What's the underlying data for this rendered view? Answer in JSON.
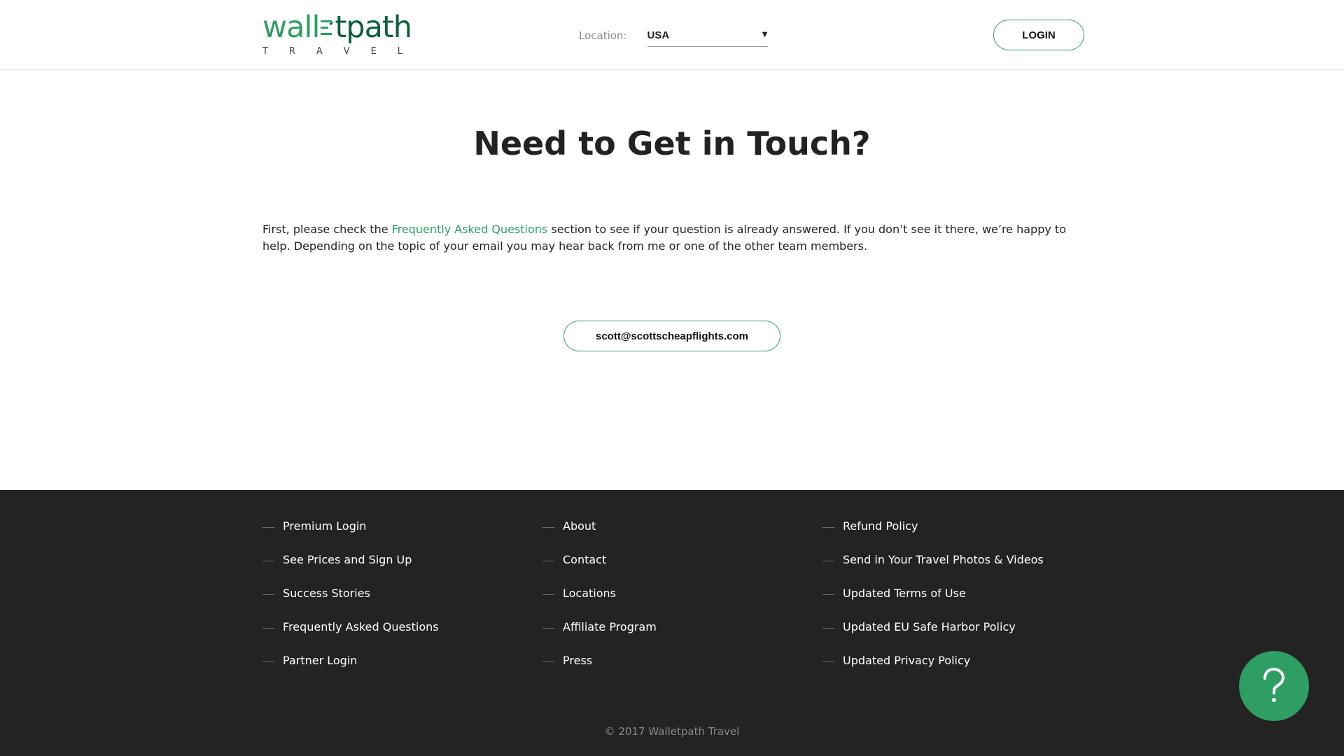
{
  "header": {
    "logo": {
      "word_left": "wall",
      "word_right": "tpath",
      "subtitle_letters": [
        "T",
        "R",
        "A",
        "V",
        "E",
        "L"
      ]
    },
    "location": {
      "label": "Location:",
      "value": "USA"
    },
    "login_label": "LOGIN"
  },
  "main": {
    "title": "Need to Get in Touch?",
    "intro_before": "First, please check the ",
    "intro_link": "Frequently Asked Questions",
    "intro_after": " section to see if your question is already answered. If you don’t see it there, we’re happy to help. Depending on the topic of your email you may hear back from me or one of the other team members.",
    "email_button": "scott@scottscheapflights.com"
  },
  "footer": {
    "columns": [
      [
        "Premium Login",
        "See Prices and Sign Up",
        "Success Stories",
        "Frequently Asked Questions",
        "Partner Login"
      ],
      [
        "About",
        "Contact",
        "Locations",
        "Affiliate Program",
        "Press"
      ],
      [
        "Refund Policy",
        "Send in Your Travel Photos & Videos",
        "Updated Terms of Use",
        "Updated EU Safe Harbor Policy",
        "Updated Privacy Policy"
      ]
    ],
    "copyright": "© 2017 Walletpath Travel"
  },
  "help_button": {
    "icon": "question-mark-icon"
  },
  "colors": {
    "brand_green": "#2e9e63",
    "brand_dark_green": "#0d5f3c",
    "footer_bg": "#232323"
  }
}
